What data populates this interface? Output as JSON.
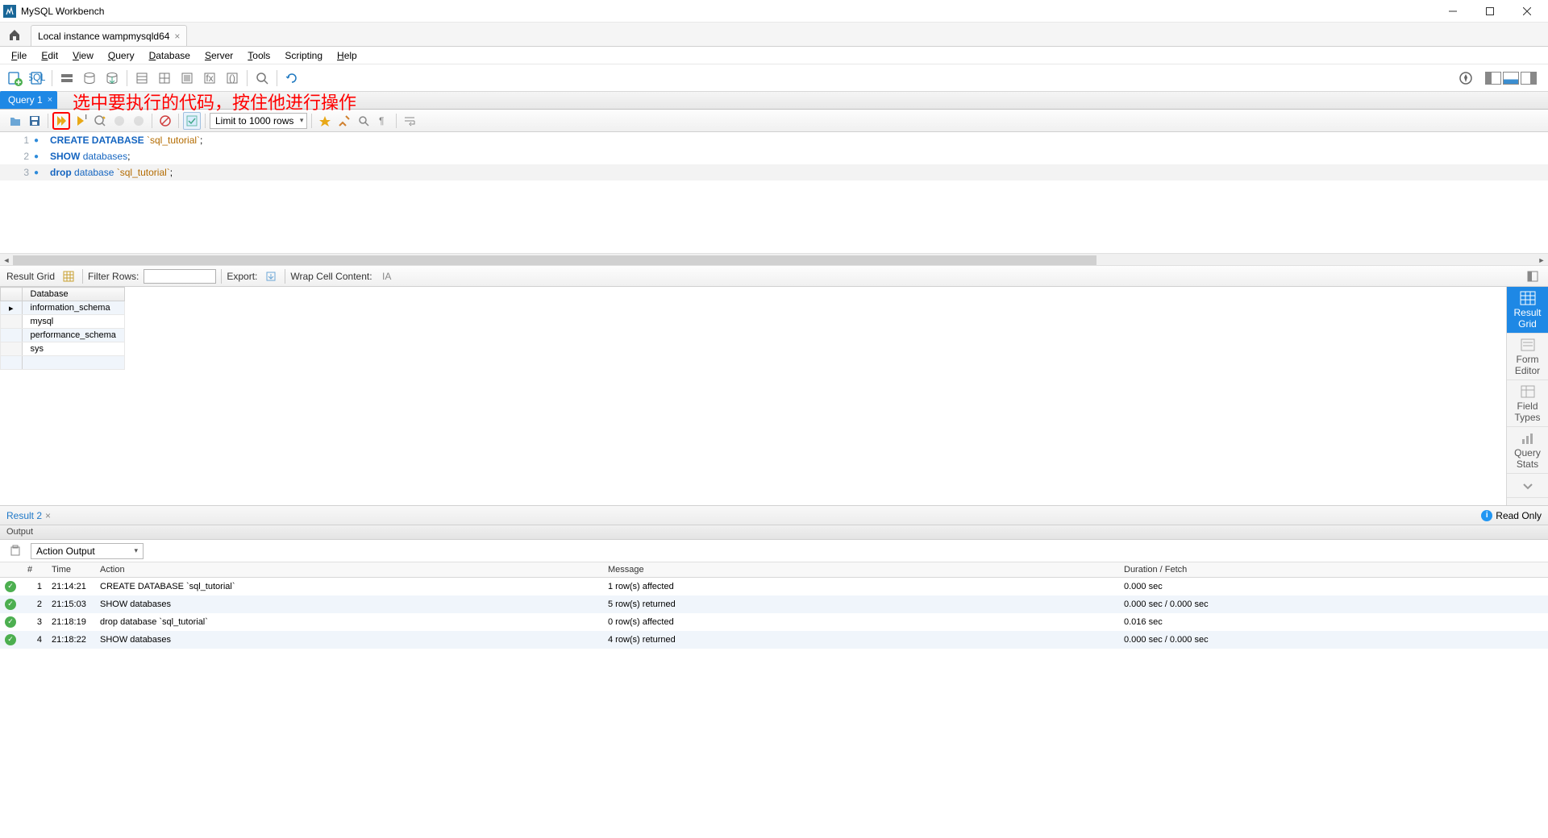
{
  "window": {
    "title": "MySQL Workbench"
  },
  "conn_tab": {
    "label": "Local instance wampmysqld64"
  },
  "menu": {
    "file": "File",
    "edit": "Edit",
    "view": "View",
    "query": "Query",
    "database": "Database",
    "server": "Server",
    "tools": "Tools",
    "scripting": "Scripting",
    "help": "Help"
  },
  "query_tab": {
    "label": "Query 1"
  },
  "annotation": "选中要执行的代码，按住他进行操作",
  "editor_toolbar": {
    "limit": "Limit to 1000 rows"
  },
  "sql_lines": [
    {
      "n": 1,
      "html": "<span class='kw'>CREATE DATABASE</span> <span class='str'>`sql_tutorial`</span>;"
    },
    {
      "n": 2,
      "html": "<span class='kw'>SHOW</span> <span class='ident'>databases</span>;"
    },
    {
      "n": 3,
      "html": "<span class='kw'>drop</span> <span class='ident'>database</span> <span class='str'>`sql_tutorial`</span>;"
    }
  ],
  "result_toolbar": {
    "grid": "Result Grid",
    "filter": "Filter Rows:",
    "export": "Export:",
    "wrap": "Wrap Cell Content:"
  },
  "result": {
    "header": "Database",
    "rows": [
      "information_schema",
      "mysql",
      "performance_schema",
      "sys"
    ]
  },
  "vtabs": {
    "grid": "Result\nGrid",
    "form": "Form\nEditor",
    "field": "Field\nTypes",
    "stats": "Query\nStats"
  },
  "result_tab": {
    "label": "Result 2"
  },
  "readonly": "Read Only",
  "output": {
    "header": "Output",
    "combo": "Action Output",
    "cols": {
      "idx": "#",
      "time": "Time",
      "action": "Action",
      "message": "Message",
      "duration": "Duration / Fetch"
    },
    "rows": [
      {
        "idx": "1",
        "time": "21:14:21",
        "action": "CREATE DATABASE `sql_tutorial`",
        "message": "1 row(s) affected",
        "duration": "0.000 sec"
      },
      {
        "idx": "2",
        "time": "21:15:03",
        "action": "SHOW databases",
        "message": "5 row(s) returned",
        "duration": "0.000 sec / 0.000 sec"
      },
      {
        "idx": "3",
        "time": "21:18:19",
        "action": "drop database `sql_tutorial`",
        "message": "0 row(s) affected",
        "duration": "0.016 sec"
      },
      {
        "idx": "4",
        "time": "21:18:22",
        "action": "SHOW databases",
        "message": "4 row(s) returned",
        "duration": "0.000 sec / 0.000 sec"
      }
    ]
  }
}
